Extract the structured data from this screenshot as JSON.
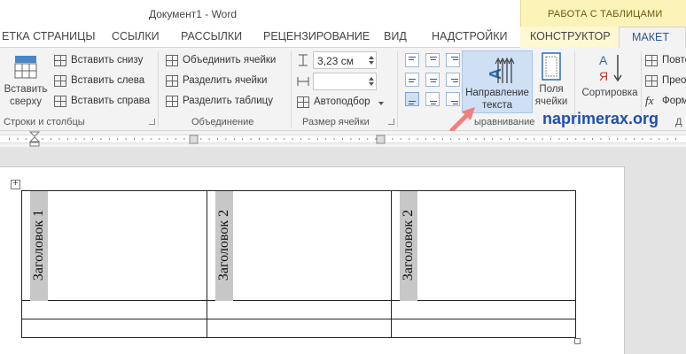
{
  "window": {
    "title": "Документ1 - Word"
  },
  "context": {
    "header": "РАБОТА С ТАБЛИЦАМИ"
  },
  "tabs": [
    {
      "label": "ЕТКА СТРАНИЦЫ"
    },
    {
      "label": "ССЫЛКИ"
    },
    {
      "label": "РАССЫЛКИ"
    },
    {
      "label": "РЕЦЕНЗИРОВАНИЕ"
    },
    {
      "label": "ВИД"
    },
    {
      "label": "НАДСТРОЙКИ"
    },
    {
      "label": "КОНСТРУКТОР"
    },
    {
      "label": "МАКЕТ"
    }
  ],
  "ribbon": {
    "rows_cols": {
      "insert_above": "Вставить\nсверху",
      "insert_below": "Вставить снизу",
      "insert_left": "Вставить слева",
      "insert_right": "Вставить справа",
      "label": "Строки и столбцы"
    },
    "merge": {
      "merge_cells": "Объединить ячейки",
      "split_cells": "Разделить ячейки",
      "split_table": "Разделить таблицу",
      "label": "Объединение"
    },
    "cell_size": {
      "height_value": "3,23 см",
      "width_value": "",
      "autofit": "Автоподбор",
      "label": "Размер ячейки"
    },
    "alignment": {
      "text_direction": "Направление\nтекста",
      "cell_margins": "Поля\nячейки",
      "label": "Выравнивание",
      "label_visible": "ыравнивание"
    },
    "sort": {
      "label": "Сортировка"
    },
    "data": {
      "repeat_header": "Повто",
      "convert": "Прео",
      "formula": "Форм",
      "label": "Д"
    }
  },
  "watermark": "naprimerax.org",
  "table": {
    "headers": [
      "Заголовок 1",
      "Заголовок 2",
      "Заголовок 2"
    ],
    "rows": [
      [
        "",
        "",
        ""
      ],
      [
        "",
        "",
        ""
      ]
    ]
  },
  "colors": {
    "accent": "#2b579a",
    "context_tab": "#fcf3b8",
    "selected_button": "#cfe0f4",
    "arrow": "#f08080"
  }
}
